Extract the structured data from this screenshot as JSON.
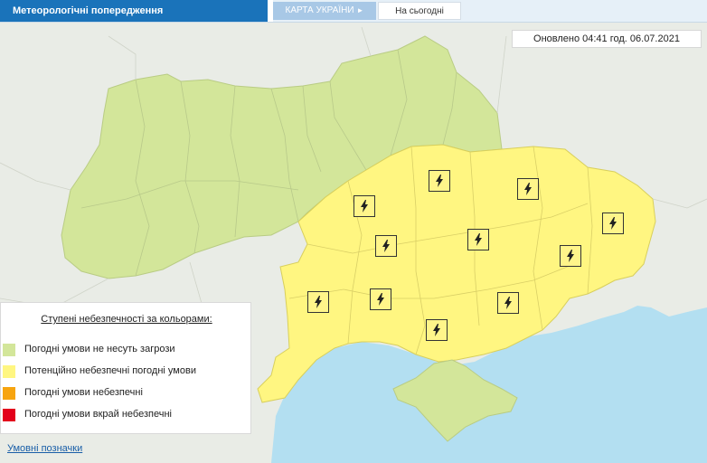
{
  "header": {
    "title": "Метеорологічні попередження",
    "tab_map": "КАРТА УКРАЇНИ",
    "tab_map_arrow": "►",
    "tab_today": "На сьогодні"
  },
  "updated": "Оновлено 04:41 год. 06.07.2021",
  "legend": {
    "title": "Ступені небезпечності за кольорами:",
    "items": [
      {
        "label": "Погодні умови не несуть загрози",
        "color": "#d3e69a"
      },
      {
        "label": "Потенційно небезпечні погодні умови",
        "color": "#fff681"
      },
      {
        "label": "Погодні умови небезпечні",
        "color": "#f7a40f"
      },
      {
        "label": "Погодні умови вкрай небезпечні",
        "color": "#e3001b"
      }
    ]
  },
  "footer_link": "Умовні позначки",
  "colors": {
    "safe": "#d3e69a",
    "caution": "#fff681",
    "water": "#b3dff1",
    "header": "#1a73ba"
  },
  "map": {
    "warning_icon": "lightning-icon",
    "warning_level": "Потенційно небезпечні погодні умови"
  }
}
